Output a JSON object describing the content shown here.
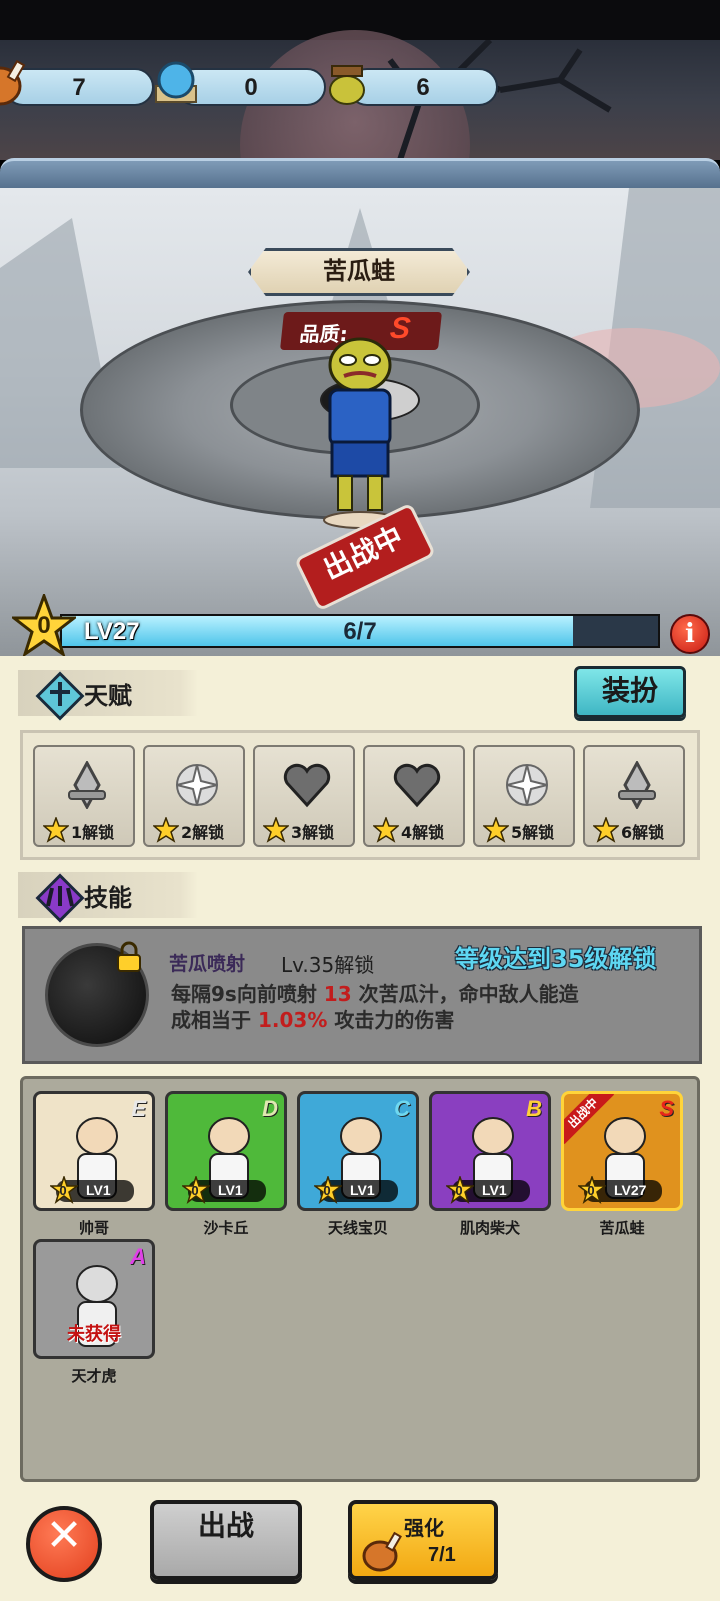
{
  "resources": [
    {
      "icon": "meat-icon",
      "value": "7"
    },
    {
      "icon": "blue-orb-icon",
      "value": "0"
    },
    {
      "icon": "frog-head-icon",
      "value": "6"
    }
  ],
  "hero": {
    "name": "苦瓜蛙",
    "quality_label": "品质:",
    "quality_value": "S",
    "status_stamp": "出战中",
    "stars": "0",
    "level_label": "LV27",
    "progress_text": "6/7",
    "progress": {
      "current": 6,
      "max": 7
    },
    "info_symbol": "i"
  },
  "talent_section": {
    "title": "天赋",
    "dress_button": "装扮",
    "slots": [
      {
        "icon": "diamond-blade-icon",
        "label": "1解锁"
      },
      {
        "icon": "spiral-icon",
        "label": "2解锁"
      },
      {
        "icon": "heart-icon",
        "label": "3解锁"
      },
      {
        "icon": "heart-icon",
        "label": "4解锁"
      },
      {
        "icon": "spiral-icon",
        "label": "5解锁"
      },
      {
        "icon": "diamond-blade-icon",
        "label": "6解锁"
      }
    ]
  },
  "skill_section": {
    "title": "技能",
    "skill_name": "苦瓜喷射",
    "skill_level": "Lv.35解锁",
    "unlock_hint": "等级达到35级解锁",
    "desc_a": "每隔9s向前喷射",
    "desc_count": "13",
    "desc_b": "次苦瓜汁，命中敌人能造",
    "desc_c": "成相当于",
    "desc_pct": "1.03%",
    "desc_d": "攻击力的伤害"
  },
  "roster": [
    {
      "name": "帅哥",
      "grade": "E",
      "stars": "0",
      "level": "LV1",
      "grade_color": "#e8e8e8",
      "bg": "#efe3c8"
    },
    {
      "name": "沙卡丘",
      "grade": "D",
      "stars": "0",
      "level": "LV1",
      "grade_color": "#dfe8b0",
      "bg": "#4fb93a"
    },
    {
      "name": "天线宝贝",
      "grade": "C",
      "stars": "0",
      "level": "LV1",
      "grade_color": "#6fd8f0",
      "bg": "#3fa9d8"
    },
    {
      "name": "肌肉柴犬",
      "grade": "B",
      "stars": "0",
      "level": "LV1",
      "grade_color": "#ffcf3a",
      "bg": "#8a3fc0"
    },
    {
      "name": "苦瓜蛙",
      "grade": "S",
      "stars": "0",
      "level": "LV27",
      "grade_color": "#e8241a",
      "bg": "#e0921e",
      "badge": "出战中"
    },
    {
      "name": "天才虎",
      "grade": "A",
      "status": "未获得",
      "grade_color": "#e040e8",
      "bg": "#9a9a9a"
    }
  ],
  "buttons": {
    "close": "✕",
    "deploy": "出战",
    "enhance": "强化",
    "enhance_cost": "7/1"
  }
}
